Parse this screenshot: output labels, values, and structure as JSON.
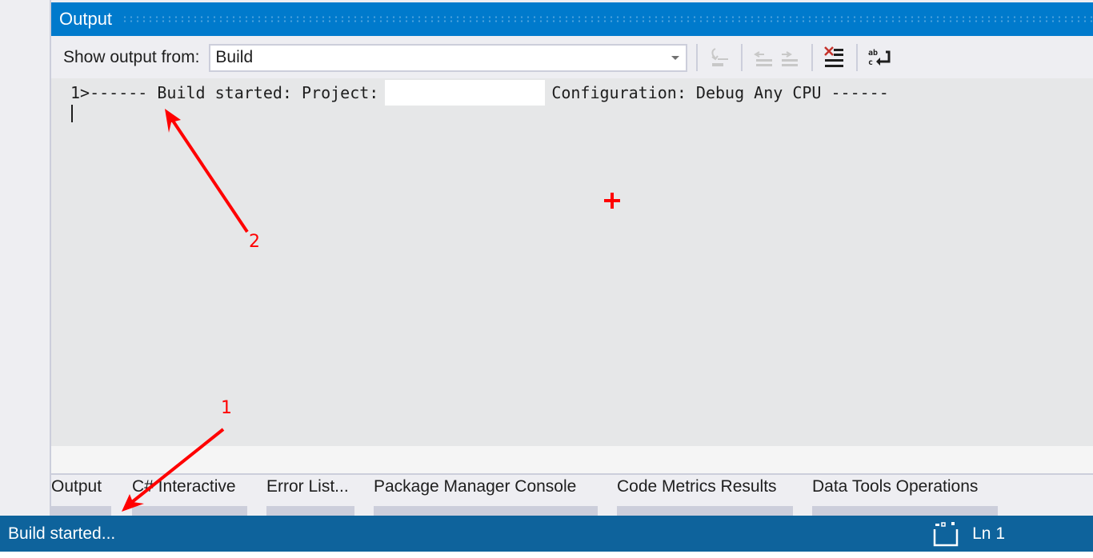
{
  "panel": {
    "title": "Output",
    "toolbar": {
      "show_output_label": "Show output from:",
      "source_selected": "Build",
      "buttons": [
        {
          "name": "go-to-build-error-icon",
          "enabled": false
        },
        {
          "name": "find-previous-message-icon",
          "enabled": false
        },
        {
          "name": "find-next-message-icon",
          "enabled": false
        },
        {
          "name": "clear-all-icon",
          "enabled": true
        },
        {
          "name": "toggle-word-wrap-icon",
          "enabled": true
        }
      ]
    },
    "output": {
      "line_prefix": "1>------ Build started: Project:",
      "line_suffix": "Configuration: Debug Any CPU ------"
    }
  },
  "tabs": [
    {
      "label": "Output"
    },
    {
      "label": "C# Interactive"
    },
    {
      "label": "Error List..."
    },
    {
      "label": "Package Manager Console"
    },
    {
      "label": "Code Metrics Results"
    },
    {
      "label": "Data Tools Operations"
    }
  ],
  "status_bar": {
    "text": "Build started...",
    "line_indicator": "Ln 1",
    "color": "#0e639c"
  },
  "annotations": [
    {
      "label": "1",
      "color": "#ff0000"
    },
    {
      "label": "2",
      "color": "#ff0000"
    }
  ],
  "colors": {
    "title_bar": "#007acc",
    "output_bg": "#e6e7e8",
    "annotation": "#ff0000"
  }
}
